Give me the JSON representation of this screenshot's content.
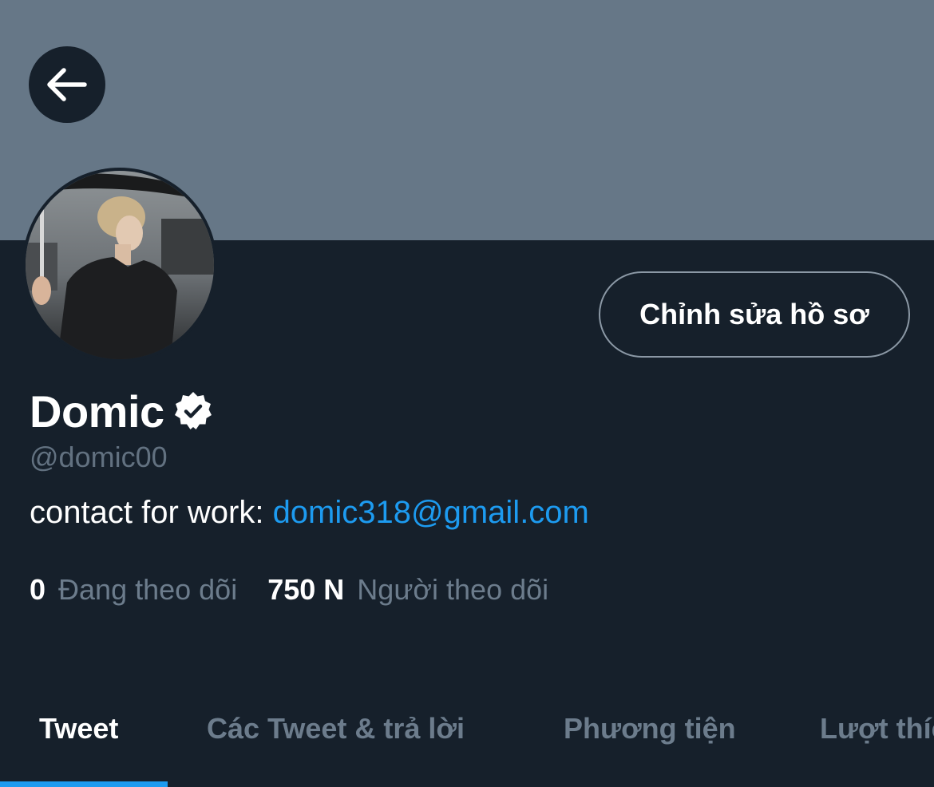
{
  "header": {
    "back_icon": "arrow-left-icon"
  },
  "profile": {
    "edit_button_label": "Chỉnh sửa hồ sơ",
    "display_name": "Domic",
    "verified_icon": "verified-badge-icon",
    "handle": "@domic00",
    "bio_prefix": "contact for work: ",
    "bio_link": "domic318@gmail.com"
  },
  "stats": {
    "following_count": "0",
    "following_label": "Đang theo dõi",
    "followers_count": "750 N",
    "followers_label": "Người theo dõi"
  },
  "tabs": [
    {
      "label": "Tweet",
      "active": true
    },
    {
      "label": "Các Tweet & trả lời",
      "active": false
    },
    {
      "label": "Phương tiện",
      "active": false
    },
    {
      "label": "Lượt thích",
      "active": false
    }
  ],
  "colors": {
    "banner": "#667787",
    "background": "#16202b",
    "accent": "#1d9bf0",
    "muted_text": "#6c7c8c"
  }
}
